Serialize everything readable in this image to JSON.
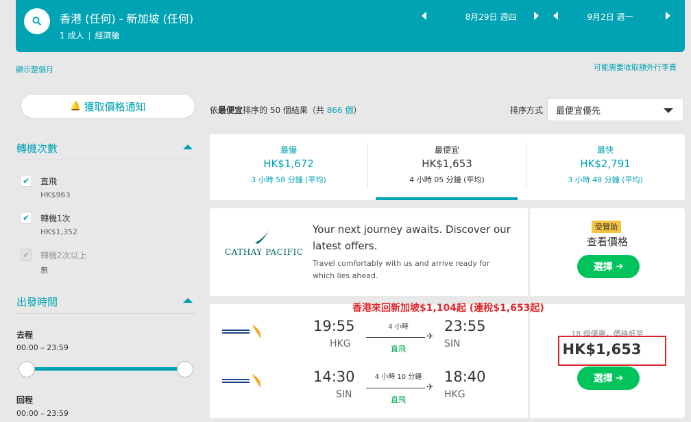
{
  "search": {
    "route": "香港 (任何) - 新加坡 (任何)",
    "passengers": "1 成人",
    "cabin": "經濟艙",
    "depart_date": "8月29日 週四",
    "return_date": "9月2日 週一"
  },
  "links": {
    "show_month": "顯示整個月",
    "baggage_fees": "可能需要收取額外行李費"
  },
  "price_alert": "獲取價格通知",
  "filters": {
    "stops_title": "轉機次數",
    "stops": [
      {
        "label": "直飛",
        "price": "HK$963",
        "checked": true
      },
      {
        "label": "轉機1次",
        "price": "HK$1,352",
        "checked": true
      },
      {
        "label": "轉機2次以上",
        "price": "無",
        "checked": true
      }
    ],
    "times_title": "出發時間",
    "outbound_label": "去程",
    "outbound_range": "00:00 – 23:59",
    "return_label": "回程",
    "return_range": "00:00 – 23:59"
  },
  "results": {
    "count_prefix": "依",
    "count_bold": "最便宜",
    "count_middle": "排序的 50 個結果（共 ",
    "total": "866 個",
    "count_suffix": "）",
    "sort_label": "排序方式",
    "sort_value": "最便宜優先"
  },
  "tabs": [
    {
      "label": "最優",
      "price": "HK$1,672",
      "duration": "3 小時 58 分鐘 (平均)"
    },
    {
      "label": "最便宜",
      "price": "HK$1,653",
      "duration": "4 小時 05 分鐘 (平均)"
    },
    {
      "label": "最快",
      "price": "HK$2,791",
      "duration": "3 小時 48 分鐘 (平均)"
    }
  ],
  "ad": {
    "brand": "CATHAY PACIFIC",
    "headline": "Your next journey awaits. Discover our latest offers.",
    "body": "Travel comfortably with us and arrive ready for which lies ahead.",
    "sponsored": "受贊助",
    "view_price": "查看價格",
    "select": "選擇"
  },
  "promo": "香港來回新加坡$1,104起 (連稅$1,653起)",
  "flight": {
    "airline": "SINGAPORE AIRLINES",
    "deals": "18 個優惠，價格低至",
    "price": "HK$1,653",
    "select": "選擇",
    "legs": [
      {
        "depart": "19:55",
        "from": "HKG",
        "duration": "4 小時",
        "stops": "直飛",
        "arrive": "23:55",
        "to": "SIN"
      },
      {
        "depart": "14:30",
        "from": "SIN",
        "duration": "4 小時 10 分鐘",
        "stops": "直飛",
        "arrive": "18:40",
        "to": "HKG"
      }
    ]
  },
  "colors": {
    "brand": "#00a3b4",
    "green": "#00c35c",
    "red": "#e0262b"
  }
}
